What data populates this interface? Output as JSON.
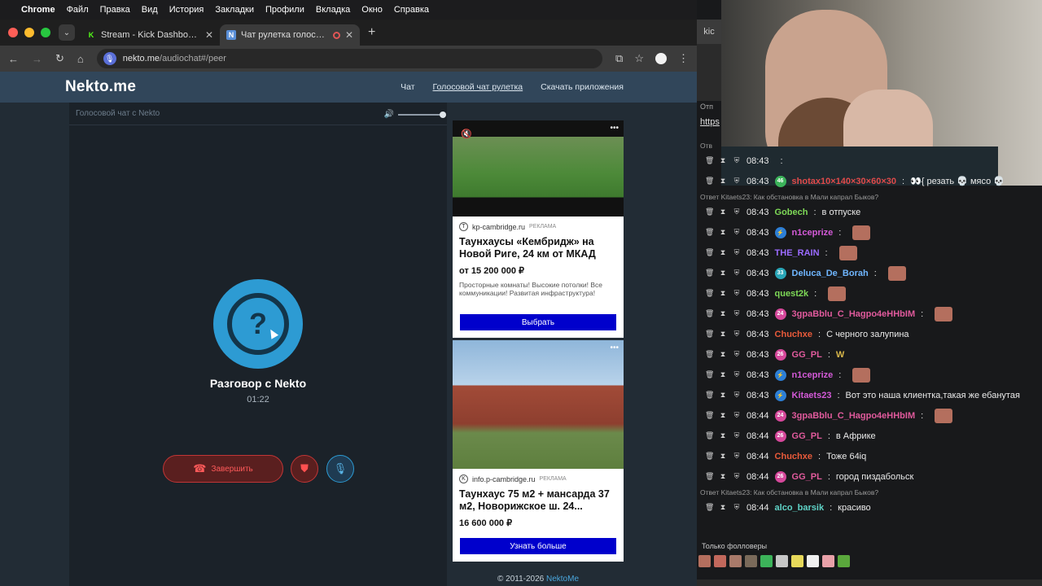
{
  "menubar": {
    "app_name": "Chrome",
    "items": [
      "Файл",
      "Правка",
      "Вид",
      "История",
      "Закладки",
      "Профили",
      "Вкладка",
      "Окно",
      "Справка"
    ]
  },
  "tabs": [
    {
      "title": "Stream - Kick Dashboard",
      "favicon": "K",
      "color": "#53fc18",
      "active": false
    },
    {
      "title": "Чат рулетка голосовая – ",
      "favicon": "N",
      "color": "#5a8fd8",
      "active": true
    }
  ],
  "address": {
    "host": "nekto.me",
    "path": "/audiochat#/peer"
  },
  "nekto": {
    "logo": "Nekto.me",
    "nav": [
      "Чат",
      "Голосовой чат рулетка",
      "Скачать приложения"
    ],
    "panel_title": "Голосовой чат с Nekto",
    "avatar_glyph": "?",
    "call_title": "Разговор с Nekto",
    "call_time": "01:22",
    "end_label": "Завершить",
    "copyright": "© 2011-2026",
    "copyright_link": "NektoMe"
  },
  "ads": [
    {
      "source": "kp-cambridge.ru",
      "tag": "РЕКЛАМА",
      "headline": "Таунхаусы «Кембридж» на Новой Риге, 24 км от МКАД",
      "price": "от 15 200 000 ₽",
      "desc": "Просторные комнаты! Высокие потолки! Все коммуникации! Развитая инфраструктура!",
      "button": "Выбрать"
    },
    {
      "source": "info.p-cambridge.ru",
      "tag": "РЕКЛАМА",
      "headline": "Таунхаус 75 м2 + мансарда 37 м2, Новорижское ш. 24...",
      "price": "16 600 000 ₽",
      "button": "Узнать больше"
    }
  ],
  "side": {
    "tab_label": "kic",
    "note1": "Отп",
    "note2": "https"
  },
  "chat": [
    {
      "type": "reply",
      "text": "Отв"
    },
    {
      "type": "msg",
      "time": "08:43",
      "user": "",
      "text": "",
      "color": "#e05a9c"
    },
    {
      "type": "msg",
      "time": "08:43",
      "badge": "46",
      "badge_color": "#3cb35a",
      "user": "shotax10×140×30×60×30",
      "color": "#e04a4a",
      "text": "👀{ резать 💀 мясо 💀"
    },
    {
      "type": "reply",
      "text": "Ответ Kitaets23: Как обстановка в Мали капрал Быков?"
    },
    {
      "type": "msg",
      "time": "08:43",
      "user": "Gobech",
      "color": "#7ed957",
      "text": "в отпуске"
    },
    {
      "type": "msg",
      "time": "08:43",
      "badge": "⚡",
      "badge_color": "#2d7fd6",
      "user": "n1ceprize",
      "color": "#d45ad8",
      "text": "",
      "emote": true
    },
    {
      "type": "msg",
      "time": "08:43",
      "user": "THE_RAIN",
      "color": "#9b6bff",
      "text": "",
      "emote": true
    },
    {
      "type": "msg",
      "time": "08:43",
      "badge": "33",
      "badge_color": "#2aa6b8",
      "user": "Deluca_De_Borah",
      "color": "#6fb6ff",
      "text": "",
      "emote": true
    },
    {
      "type": "msg",
      "time": "08:43",
      "user": "quest2k",
      "color": "#7ed957",
      "text": "",
      "emote": true
    },
    {
      "type": "msg",
      "time": "08:43",
      "badge": "24",
      "badge_color": "#d6489b",
      "user": "3gpaBblu_C_Hagpo4eHHbIM",
      "color": "#e05a9c",
      "text": "",
      "emote": true
    },
    {
      "type": "msg",
      "time": "08:43",
      "user": "Chuchxe",
      "color": "#e85a3a",
      "text": "С черного залупина"
    },
    {
      "type": "msg",
      "time": "08:43",
      "badge": "26",
      "badge_color": "#d6489b",
      "user": "GG_PL",
      "color": "#e05a9c",
      "text": "W"
    },
    {
      "type": "msg",
      "time": "08:43",
      "badge": "⚡",
      "badge_color": "#2d7fd6",
      "user": "n1ceprize",
      "color": "#d45ad8",
      "text": "",
      "emote": true
    },
    {
      "type": "msg",
      "time": "08:43",
      "badge": "⚡",
      "badge_color": "#2d7fd6",
      "user": "Kitaets23",
      "color": "#d45ad8",
      "text": "Вот это наша клиентка,такая же ебанутая"
    },
    {
      "type": "msg",
      "time": "08:44",
      "badge": "24",
      "badge_color": "#d6489b",
      "user": "3gpaBblu_C_Hagpo4eHHbIM",
      "color": "#e05a9c",
      "text": "",
      "emote": true
    },
    {
      "type": "msg",
      "time": "08:44",
      "badge": "26",
      "badge_color": "#d6489b",
      "user": "GG_PL",
      "color": "#e05a9c",
      "text": "в Африке"
    },
    {
      "type": "msg",
      "time": "08:44",
      "user": "Chuchxe",
      "color": "#e85a3a",
      "text": "Тоже 64iq"
    },
    {
      "type": "msg",
      "time": "08:44",
      "badge": "26",
      "badge_color": "#d6489b",
      "user": "GG_PL",
      "color": "#e05a9c",
      "text": "город пиздабольск"
    },
    {
      "type": "reply",
      "text": "Ответ Kitaets23: Как обстановка в Мали капрал Быков?"
    },
    {
      "type": "msg",
      "time": "08:44",
      "user": "alco_barsik",
      "color": "#5fd3c7",
      "text": "красиво"
    }
  ],
  "followers_label": "Только фолловеры"
}
